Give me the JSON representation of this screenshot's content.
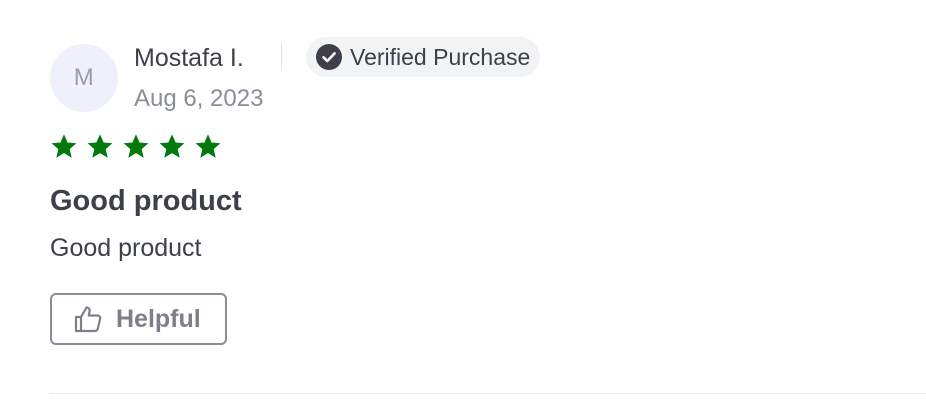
{
  "review": {
    "author": {
      "initial": "M",
      "name": "Mostafa I."
    },
    "verified_badge": {
      "label": "Verified Purchase",
      "icon": "check-circle-icon"
    },
    "date": "Aug 6, 2023",
    "rating": 5,
    "rating_max": 5,
    "star_color": "#007a0c",
    "title": "Good product",
    "body": "Good product",
    "helpful_button": {
      "label": "Helpful",
      "icon": "thumbs-up-icon"
    }
  }
}
